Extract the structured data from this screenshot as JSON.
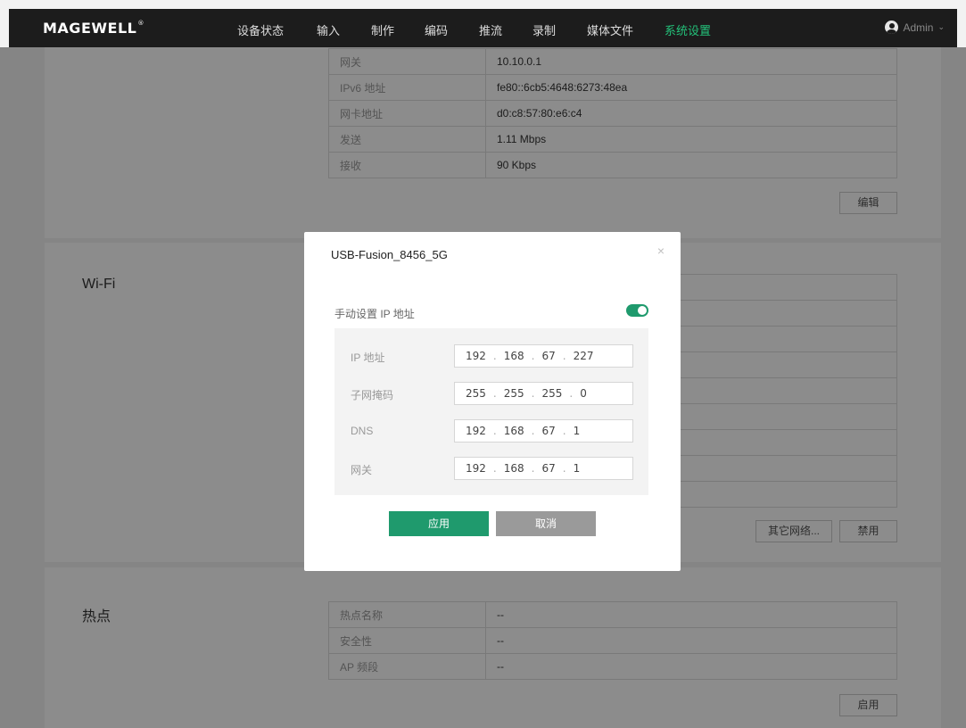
{
  "brand": "MAGEWELL",
  "nav": [
    "设备状态",
    "输入",
    "制作",
    "编码",
    "推流",
    "录制",
    "媒体文件",
    "系统设置"
  ],
  "user": "Admin",
  "ethernet": {
    "rows": [
      {
        "k": "网关",
        "v": "10.10.0.1"
      },
      {
        "k": "IPv6 地址",
        "v": "fe80::6cb5:4648:6273:48ea"
      },
      {
        "k": "网卡地址",
        "v": "d0:c8:57:80:e6:c4"
      },
      {
        "k": "发送",
        "v": "1.11 Mbps"
      },
      {
        "k": "接收",
        "v": "90 Kbps"
      }
    ],
    "edit_button": "编辑"
  },
  "wifi": {
    "title": "Wi-Fi",
    "other_networks_button": "其它网络...",
    "disable_button": "禁用"
  },
  "hotspot": {
    "title": "热点",
    "rows": [
      {
        "k": "热点名称",
        "v": "--"
      },
      {
        "k": "安全性",
        "v": "--"
      },
      {
        "k": "AP 频段",
        "v": "--"
      }
    ],
    "enable_button": "启用"
  },
  "modal": {
    "title": "USB-Fusion_8456_5G",
    "toggle_label": "手动设置 IP 地址",
    "toggle_on": true,
    "fields": [
      {
        "label": "IP 地址",
        "octets": [
          "192",
          "168",
          "67",
          "227"
        ]
      },
      {
        "label": "子网掩码",
        "octets": [
          "255",
          "255",
          "255",
          "0"
        ]
      },
      {
        "label": "DNS",
        "octets": [
          "192",
          "168",
          "67",
          "1"
        ]
      },
      {
        "label": "网关",
        "octets": [
          "192",
          "168",
          "67",
          "1"
        ]
      }
    ],
    "apply_button": "应用",
    "cancel_button": "取消"
  },
  "colors": {
    "accent": "#1f9a6d",
    "nav_active": "#23c27a",
    "topbar": "#1c1c1c",
    "cancel": "#9a9a9a"
  }
}
